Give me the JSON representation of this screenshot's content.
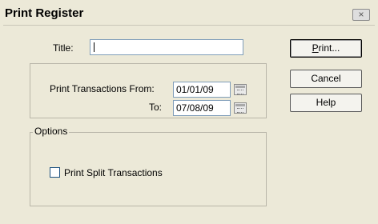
{
  "window": {
    "title": "Print Register",
    "close_label": "×"
  },
  "form": {
    "title_label": "Title:",
    "title_value": "",
    "from_label": "Print Transactions From:",
    "from_date": "01/01/09",
    "to_label": "To:",
    "to_date": "07/08/09"
  },
  "options": {
    "group_label": "Options",
    "split_label": "Print Split Transactions",
    "split_checked": false
  },
  "buttons": {
    "print_mnemonic": "P",
    "print_rest": "rint...",
    "cancel": "Cancel",
    "help": "Help"
  }
}
